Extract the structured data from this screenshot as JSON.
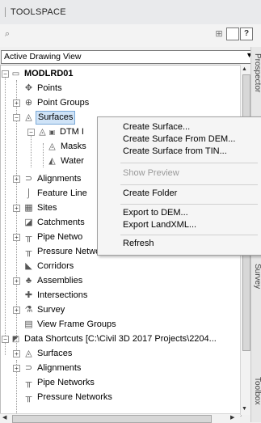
{
  "panel": {
    "title": "TOOLSPACE"
  },
  "view_selector": {
    "value": "Active Drawing View"
  },
  "tree": {
    "drawing": "MODLRD01",
    "nodes": [
      {
        "label": "Points"
      },
      {
        "label": "Point Groups"
      },
      {
        "label": "Surfaces"
      },
      {
        "label": "DTM I"
      },
      {
        "label": "Masks"
      },
      {
        "label": "Water"
      },
      {
        "label": "Alignments"
      },
      {
        "label": "Feature Line"
      },
      {
        "label": "Sites"
      },
      {
        "label": "Catchments"
      },
      {
        "label": "Pipe Netwo"
      },
      {
        "label": "Pressure Networks"
      },
      {
        "label": "Corridors"
      },
      {
        "label": "Assemblies"
      },
      {
        "label": "Intersections"
      },
      {
        "label": "Survey"
      },
      {
        "label": "View Frame Groups"
      },
      {
        "label": "Data Shortcuts [C:\\Civil 3D 2017 Projects\\2204..."
      },
      {
        "label": "Surfaces"
      },
      {
        "label": "Alignments"
      },
      {
        "label": "Pipe Networks"
      },
      {
        "label": "Pressure Networks"
      }
    ]
  },
  "context_menu": {
    "items": [
      {
        "label": "Create Surface..."
      },
      {
        "label": "Create Surface From DEM..."
      },
      {
        "label": "Create Surface from TIN..."
      },
      {
        "label": "Show Preview"
      },
      {
        "label": "Create Folder"
      },
      {
        "label": "Export to DEM..."
      },
      {
        "label": "Export LandXML..."
      },
      {
        "label": "Refresh"
      }
    ]
  },
  "side_tabs": [
    "Prospector",
    "Survey",
    "Toolbox"
  ]
}
